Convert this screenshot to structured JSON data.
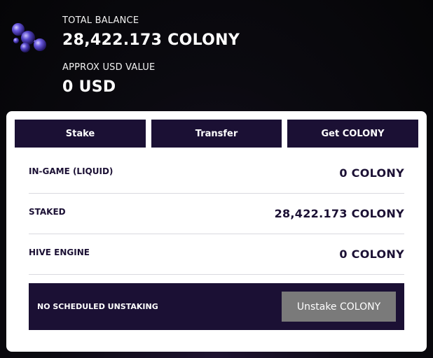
{
  "header": {
    "total_balance_label": "TOTAL BALANCE",
    "total_balance_value": "28,422.173 COLONY",
    "usd_label": "APPROX USD VALUE",
    "usd_value": "0 USD",
    "icon": "colony-token-icon"
  },
  "actions": {
    "stake_label": "Stake",
    "transfer_label": "Transfer",
    "get_label": "Get COLONY"
  },
  "balances": [
    {
      "label": "IN-GAME (LIQUID)",
      "value": "0 COLONY"
    },
    {
      "label": "STAKED",
      "value": "28,422.173 COLONY"
    },
    {
      "label": "HIVE ENGINE",
      "value": "0 COLONY"
    }
  ],
  "unstaking": {
    "status_text": "NO SCHEDULED UNSTAKING",
    "button_label": "Unstake COLONY"
  },
  "colors": {
    "panel_dark": "#1b1034",
    "button_disabled": "#7a7a7a",
    "card_bg": "#ffffff"
  }
}
